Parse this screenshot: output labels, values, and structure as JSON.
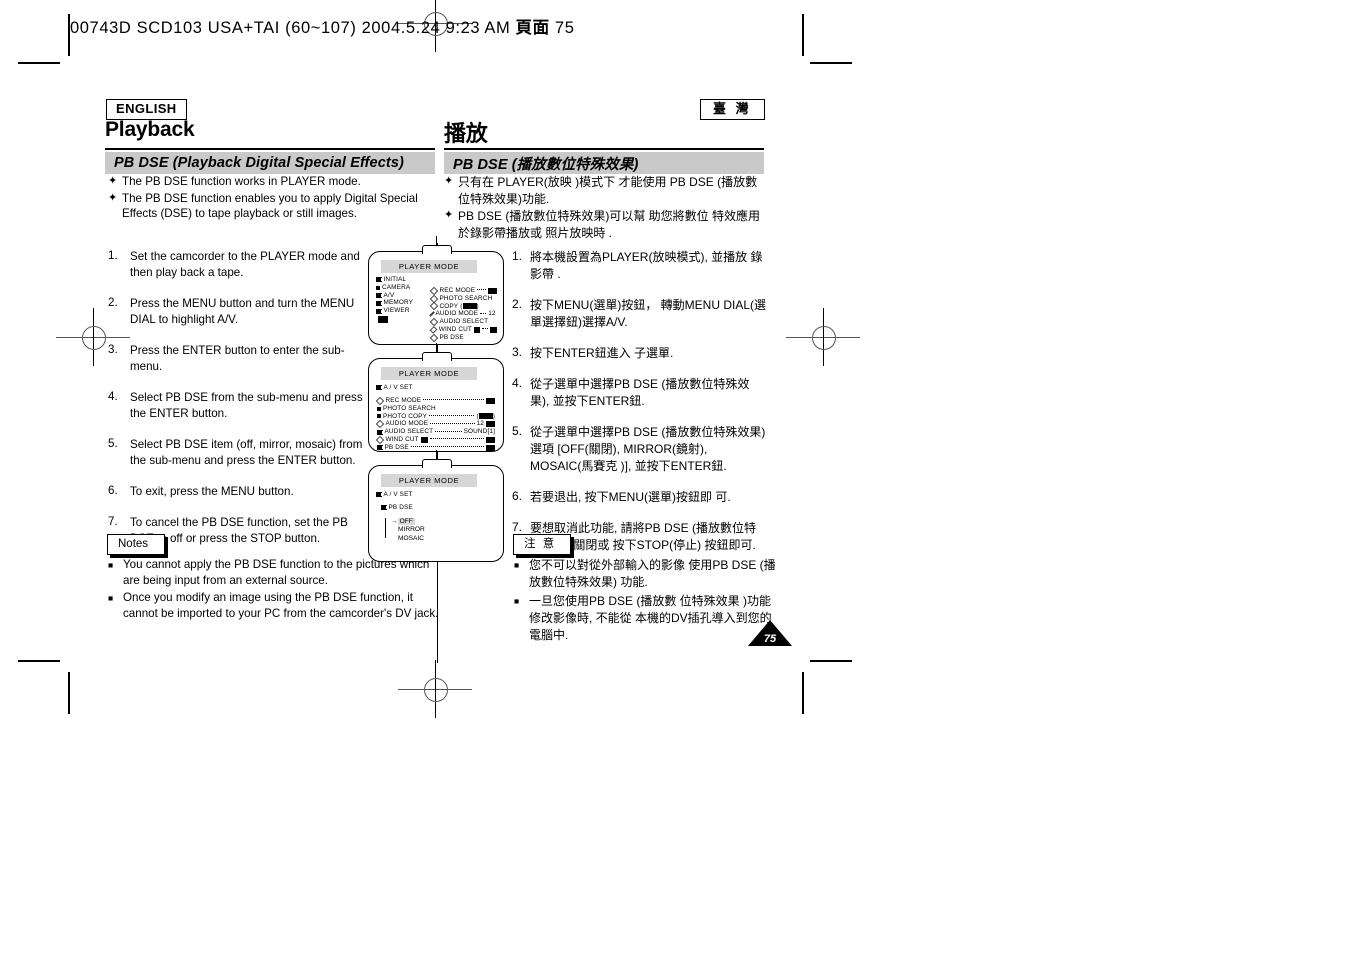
{
  "slug": {
    "text": "00743D SCD103 USA+TAI (60~107)  2004.5.24  9:23 AM",
    "cjk": "頁面",
    "page": "75"
  },
  "english": {
    "lang_tag": "ENGLISH",
    "chapter_title": "Playback",
    "section_title": "PB DSE (Playback Digital Special Effects)",
    "bullets": [
      "The PB DSE function works in PLAYER mode.",
      "The PB DSE function enables you to apply Digital Special Effects (DSE) to tape playback or still images."
    ],
    "steps": [
      {
        "num": "1.",
        "text": "Set the camcorder to the PLAYER mode and then play back a tape."
      },
      {
        "num": "2.",
        "text": "Press the MENU button and turn the MENU DIAL to highlight A/V."
      },
      {
        "num": "3.",
        "text": "Press the ENTER button to enter the sub-menu."
      },
      {
        "num": "4.",
        "text": "Select PB DSE from the sub-menu and press the ENTER button."
      },
      {
        "num": "5.",
        "text": "Select PB DSE item (off, mirror, mosaic) from the sub-menu and press the ENTER button."
      },
      {
        "num": "6.",
        "text": "To exit, press the MENU button."
      },
      {
        "num": "7.",
        "text": "To cancel the PB DSE function, set the PB DSE to off or press the STOP button."
      }
    ],
    "notes_label": "Notes",
    "notes": [
      "You cannot apply the PB DSE function to the pictures which are being input from an external source.",
      "Once you modify an image using the PB DSE function, it cannot be imported to your PC from the camcorder's DV jack."
    ]
  },
  "chinese": {
    "lang_tag": "臺 灣",
    "chapter_title": "播放",
    "section_title": "PB DSE (播放數位特殊效果)",
    "bullets": [
      "只有在 PLAYER(放映 )模式下 才能使用 PB DSE (播放數位特殊效果)功能.",
      "PB DSE (播放數位特殊效果)可以幫 助您將數位 特效應用於錄影帶播放或 照片放映時 ."
    ],
    "steps": [
      {
        "num": "1.",
        "text": "將本機設置為PLAYER(放映模式), 並播放 錄影帶 ."
      },
      {
        "num": "2.",
        "text": "按下MENU(選單)按鈕， 轉動MENU DIAL(選單選擇鈕)選擇A/V."
      },
      {
        "num": "3.",
        "text": "按下ENTER鈕進入 子選單."
      },
      {
        "num": "4.",
        "text": "從子選單中選擇PB DSE (播放數位特殊效果), 並按下ENTER鈕."
      },
      {
        "num": "5.",
        "text": "從子選單中選擇PB DSE (播放數位特殊效果)選項 [OFF(關閉), MIRROR(鏡射), MOSAIC(馬賽克 )], 並按下ENTER鈕."
      },
      {
        "num": "6.",
        "text": "若要退出, 按下MENU(選單)按鈕即 可."
      },
      {
        "num": "7.",
        "text": "要想取消此功能, 請將PB DSE (播放數位特殊效果) 關閉或 按下STOP(停止) 按鈕即可."
      }
    ],
    "notes_label": "注 意",
    "notes": [
      "您不可以對從外部輸入的影像 使用PB DSE (播放數位特殊效果) 功能.",
      "一旦您使用PB DSE (播放數 位特殊效果 )功能修改影像時, 不能從 本機的DV插孔導入到您的電腦中."
    ]
  },
  "lcd1": {
    "mode_label": "PLAYER MODE",
    "left_items": [
      "INITIAL",
      "CAMERA",
      "A/V",
      "MEMORY",
      "VIEWER"
    ],
    "right_items": [
      {
        "label": "REC MODE",
        "value": "",
        "dots": true
      },
      {
        "label": "PHOTO SEARCH",
        "value": "",
        "dots": false
      },
      {
        "label": "COPY",
        "value": "",
        "dots": false
      },
      {
        "label": "AUDIO MODE",
        "value": "12",
        "dots": true
      },
      {
        "label": "AUDIO SELECT",
        "value": "",
        "dots": false
      },
      {
        "label": "WIND CUT",
        "value": "",
        "dots": true
      },
      {
        "label": "PB DSE",
        "value": "",
        "dots": false
      }
    ]
  },
  "lcd2": {
    "mode_label": "PLAYER MODE",
    "header": "A / V SET",
    "items": [
      {
        "label": "REC MODE",
        "value": "",
        "dots": true
      },
      {
        "label": "PHOTO SEARCH",
        "value": "",
        "dots": false
      },
      {
        "label": "PHOTO COPY",
        "value": "",
        "dots": true
      },
      {
        "label": "AUDIO MODE",
        "value": "12",
        "dots": true
      },
      {
        "label": "AUDIO SELECT",
        "value": "SOUND[1]",
        "dots": true
      },
      {
        "label": "WIND CUT",
        "value": "",
        "dots": true
      },
      {
        "label": "PB DSE",
        "value": "",
        "dots": true
      }
    ]
  },
  "lcd3": {
    "mode_label": "PLAYER MODE",
    "header": "A / V SET",
    "header2": "PB DSE",
    "options": [
      "OFF",
      "MIRROR",
      "MOSAIC"
    ],
    "selected": "OFF"
  },
  "page_number": "75",
  "colors": {
    "section_bar": "#c9c9c9",
    "lcd_mode_bar": "#d6d6d6",
    "ink": "#000000"
  }
}
